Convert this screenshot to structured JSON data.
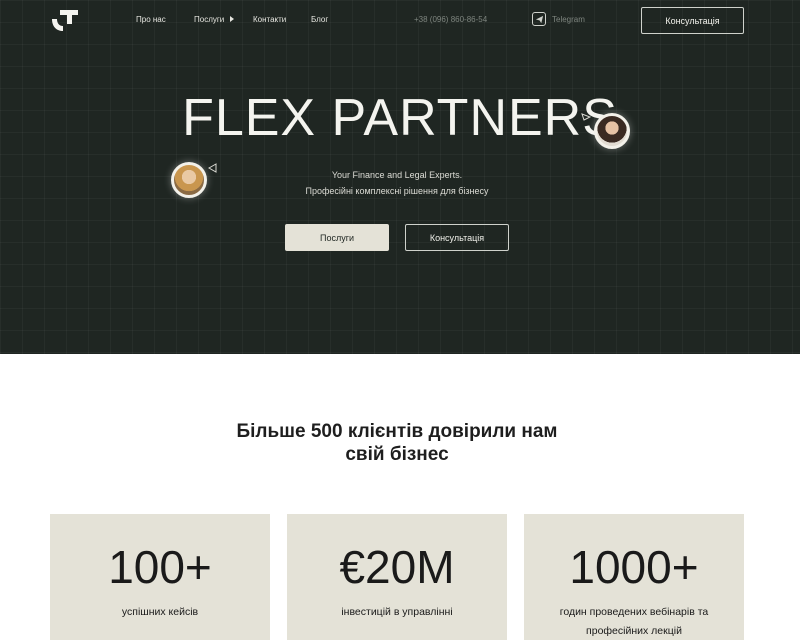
{
  "header": {
    "nav": [
      "Про нас",
      "Послуги",
      "Контакти",
      "Блог"
    ],
    "phone": "+38 (096) 860-86-54",
    "telegram_label": "Telegram",
    "cta_label": "Консультація"
  },
  "hero": {
    "title": "FLEX PARTNERS",
    "subtitle_line1": "Your Finance and Legal Experts.",
    "subtitle_line2": "Професійні комплексні рішення для бізнесу",
    "primary_button": "Послуги",
    "secondary_button": "Консультація"
  },
  "stats": {
    "headline_line1": "Більше 500 клієнтів довірили нам",
    "headline_line2": "свій бізнес",
    "cards": [
      {
        "value": "100+",
        "label": "успішних кейсів"
      },
      {
        "value": "€20M",
        "label": "інвестицій в управлінні"
      },
      {
        "value": "1000+",
        "label": "годин проведених вебінарів та професійних лекцій"
      }
    ]
  },
  "colors": {
    "hero_bg": "#1f2622",
    "card_bg": "#e4e2d7",
    "text_light": "#f4f4ef"
  }
}
